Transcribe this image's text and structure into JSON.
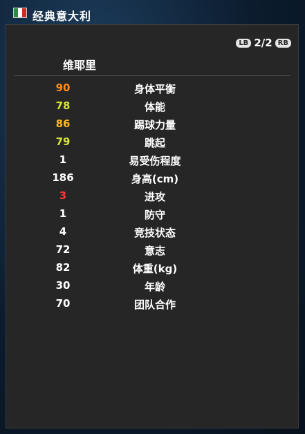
{
  "header": {
    "team_name": "经典意大利",
    "flag_colors": [
      "#2e8b3f",
      "#ffffff",
      "#d22a2a"
    ]
  },
  "pager": {
    "prev_button": "LB",
    "page": "2/2",
    "next_button": "RB"
  },
  "player": {
    "name": "维耶里"
  },
  "stats": [
    {
      "value": "90",
      "label": "身体平衡",
      "color": "#ff8a1e"
    },
    {
      "value": "78",
      "label": "体能",
      "color": "#d7e33c"
    },
    {
      "value": "86",
      "label": "踢球力量",
      "color": "#ffb81e"
    },
    {
      "value": "79",
      "label": "跳起",
      "color": "#d7e33c"
    },
    {
      "value": "1",
      "label": "易受伤程度",
      "color": "#ffffff"
    },
    {
      "value": "186",
      "label": "身高(cm)",
      "color": "#ffffff"
    },
    {
      "value": "3",
      "label": "进攻",
      "color": "#ff3535"
    },
    {
      "value": "1",
      "label": "防守",
      "color": "#ffffff"
    },
    {
      "value": "4",
      "label": "竞技状态",
      "color": "#ffffff"
    },
    {
      "value": "72",
      "label": "意志",
      "color": "#ffffff"
    },
    {
      "value": "82",
      "label": "体重(kg)",
      "color": "#ffffff"
    },
    {
      "value": "30",
      "label": "年龄",
      "color": "#ffffff"
    },
    {
      "value": "70",
      "label": "团队合作",
      "color": "#ffffff"
    }
  ]
}
